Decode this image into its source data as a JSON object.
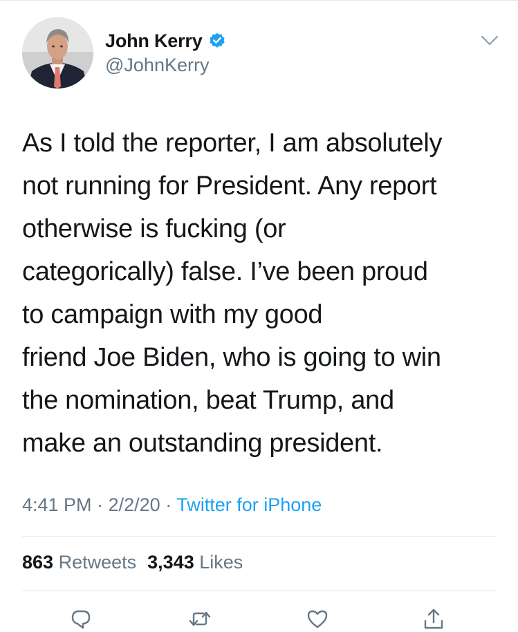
{
  "user": {
    "display_name": "John Kerry",
    "handle": "@JohnKerry",
    "verified": true,
    "verified_color": "#1da1f2"
  },
  "tweet": {
    "lines": [
      "As I told the reporter, I am absolutely",
      "not running for President. Any report",
      "otherwise is fucking (or",
      "categorically) false. I’ve been proud",
      "to campaign with my good",
      "friend Joe Biden, who is going to win",
      "the nomination, beat Trump, and",
      "make an outstanding president."
    ],
    "time": "4:41 PM",
    "date": "2/2/20",
    "separator": "·",
    "source": "Twitter for iPhone"
  },
  "stats": {
    "retweets_count": "863",
    "retweets_label": "Retweets",
    "likes_count": "3,343",
    "likes_label": "Likes"
  },
  "actions": {
    "reply_icon": "reply-icon",
    "retweet_icon": "retweet-icon",
    "like_icon": "heart-icon",
    "share_icon": "share-icon"
  },
  "colors": {
    "text": "#14171a",
    "secondary": "#657786",
    "link": "#1da1f2",
    "divider": "#e1e8ed"
  }
}
